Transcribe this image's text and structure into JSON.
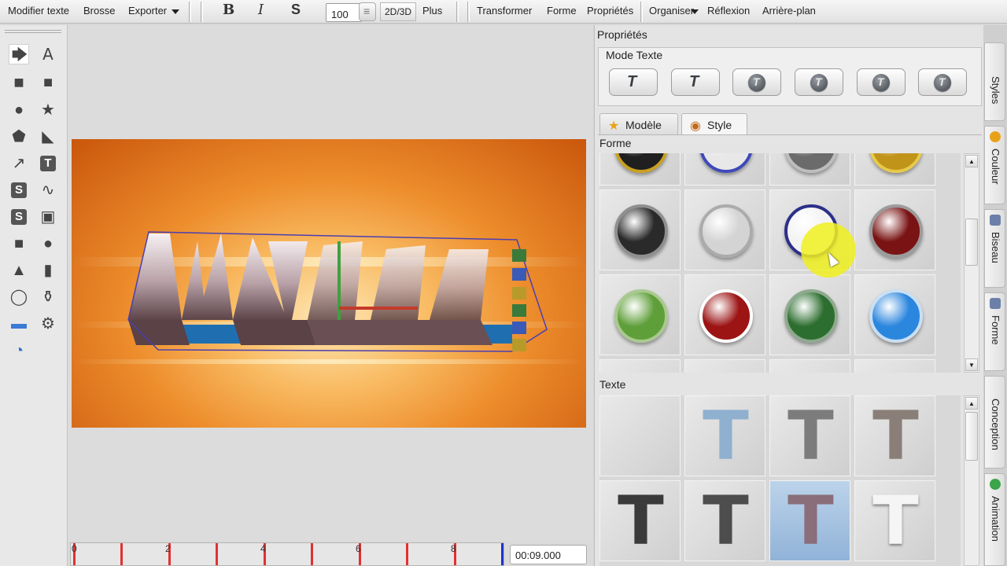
{
  "toolbar": {
    "edit_text": "Modifier texte",
    "brush": "Brosse",
    "export": "Exporter",
    "bold": "B",
    "italic": "I",
    "shadow": "S",
    "size_value": "100",
    "mode_2d3d": "2D/3D",
    "more": "Plus",
    "transform": "Transformer",
    "shape": "Forme",
    "properties": "Propriétés",
    "arrange": "Organiser",
    "reflection": "Réflexion",
    "background": "Arrière-plan"
  },
  "properties": {
    "title": "Propriétés",
    "text_mode_label": "Mode Texte",
    "tabs": [
      {
        "label": "Modèle"
      },
      {
        "label": "Style"
      }
    ],
    "shape_section": "Forme",
    "text_section": "Texte"
  },
  "timeline": {
    "ticks": [
      "0",
      "2",
      "4",
      "6",
      "8"
    ],
    "time": "00:09.000"
  },
  "side_tabs": [
    {
      "label": "Styles"
    },
    {
      "label": "Couleur"
    },
    {
      "label": "Biseau"
    },
    {
      "label": "Forme"
    },
    {
      "label": "Conception"
    },
    {
      "label": "Animation"
    }
  ],
  "shape_balls": [
    {
      "color": "#1f1f1f",
      "ring": "#c9a020"
    },
    {
      "color": "#e8e8e8",
      "ring": "#3f49b8"
    },
    {
      "color": "#6b6b6b",
      "ring": "#bdbdbd"
    },
    {
      "color": "#c09418",
      "ring": "#e8c94a"
    },
    {
      "color": "#2a2a2a",
      "ring": "#8f8f8f"
    },
    {
      "color": "#d4d4d4",
      "ring": "#ababab"
    },
    {
      "color": "#f3f3f3",
      "ring": "#2c2f8a"
    },
    {
      "color": "#7a1414",
      "ring": "#9b9b9b"
    },
    {
      "color": "#5f9f3a",
      "ring": "#a9c98f"
    },
    {
      "color": "#9c1414",
      "ring": "#ffffff"
    },
    {
      "color": "#2c6e2f",
      "ring": "#8fa98f"
    },
    {
      "color": "#2b86de",
      "ring": "#c9dff3"
    }
  ]
}
